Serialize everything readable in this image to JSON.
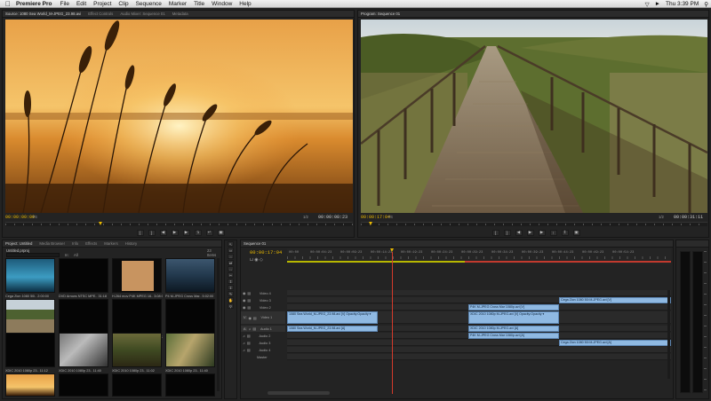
{
  "menubar": {
    "app_name": "Premiere Pro",
    "items": [
      "File",
      "Edit",
      "Project",
      "Clip",
      "Sequence",
      "Marker",
      "Title",
      "Window",
      "Help"
    ],
    "clock": "Thu 3:39 PM"
  },
  "source_monitor": {
    "tabs": [
      "Source: 1080 Sea World_M-JPEG_23.98.avi",
      "Effect Controls",
      "Audio Mixer: Sequence 01",
      "Metadata"
    ],
    "current_time": "00:00:00:00",
    "fit": "Fit",
    "resolution": "1/2",
    "duration": "00:00:08:23"
  },
  "program_monitor": {
    "tabs": [
      "Program: Sequence 01"
    ],
    "current_time": "00:00:17:04",
    "fit": "Fit",
    "resolution": "1/2",
    "duration": "00:00:31:11"
  },
  "project_panel": {
    "tabs": [
      "Project: Untitled",
      "Media Browser",
      "Info",
      "Effects",
      "Markers",
      "History"
    ],
    "project_name": "Untitled.prproj",
    "item_count": "23 Items",
    "search_in": "All",
    "items": [
      {
        "label": "Cega Zion 1080 50i..  2:00:00"
      },
      {
        "label": "DVD Arrows NTSC MPE..  31:18"
      },
      {
        "label": "H.264 mov P4K MPEG  16..  3:08:03"
      },
      {
        "label": "P4 M-JPEG Cross Mar..  5:02:00"
      },
      {
        "label": "1080 Sea World_M-J..  6:08"
      },
      {
        "label": "XDIC 1080 Spring M-JPE..  29:25"
      },
      {
        "label": "XDIC 2010 1080p M-JPE..  5:12:12"
      },
      {
        "label": "XDIC 2010 1080p 23..  15:00"
      },
      {
        "label": "XDIC 2010 1080p 23..  11:12"
      },
      {
        "label": "XDIC 2010 1080p 23..  11:40"
      },
      {
        "label": "XDIC 2010 1080p 23..  11:02"
      },
      {
        "label": "XDIC 2010 1080p 23..  11:40"
      }
    ]
  },
  "timeline": {
    "tab": "Sequence 01",
    "current_time": "00:00:17:04",
    "ruler_times": [
      "00:00",
      "00:00:04:23",
      "00:00:09:23",
      "00:00:14:23",
      "00:00:19:23",
      "00:00:24:23",
      "00:00:29:23",
      "00:00:34:23",
      "00:00:39:23",
      "00:00:44:23",
      "00:00:49:23",
      "00:00:54:23"
    ],
    "tracks": [
      "Video 4",
      "Video 3",
      "Video 2",
      "Video 1",
      "Audio 1",
      "Audio 2",
      "Audio 3",
      "Audio 4",
      "Master"
    ],
    "clips": {
      "video4": "",
      "video3": "Cega Zion 1080 50i M-JPEG.avi [V]",
      "video2": "P4K M-JPEG Cross Mar 1080p.avi [V]",
      "video1_a": "1080 Sea World_M-JPEG_23.98.avi [V]  Opacity:Opacity ▾",
      "video1_b": "XDIC 2010 1080p M-JPEG.avi [V]  Opacity:Opacity ▾",
      "audio1_a": "1080 Sea World_M-JPEG_23.98.avi [A]",
      "audio1_b": "XDIC 2010 1080p M-JPEG.avi [A]",
      "audio2": "P4K M-JPEG Cross Mar 1080p.avi [A]",
      "audio3": "Cega Zion 1080 50i M-JPEG.avi [A]"
    }
  },
  "colors": {
    "accent_time": "#e8b800",
    "clip_blue": "#8fb9e2",
    "playhead": "#d23a2b"
  }
}
